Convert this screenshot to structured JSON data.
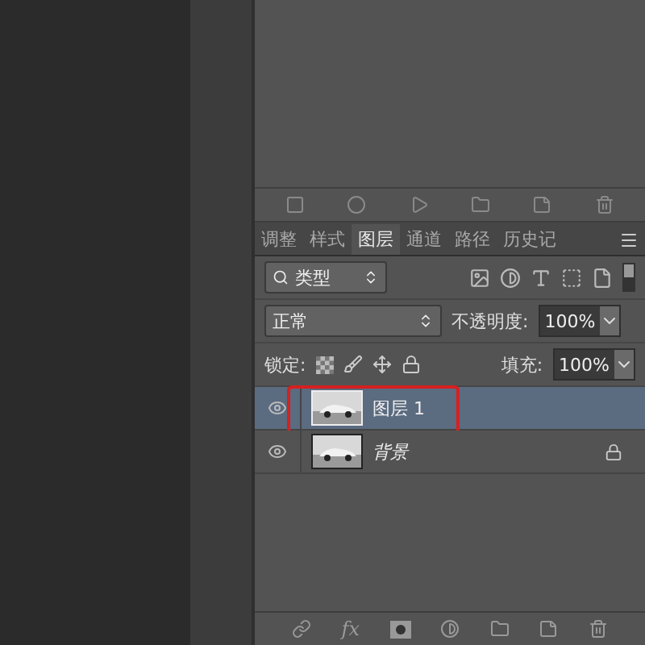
{
  "actions_toolbar": {
    "buttons": [
      {
        "kind": "stop"
      },
      {
        "kind": "record"
      },
      {
        "kind": "play"
      },
      {
        "kind": "folder"
      },
      {
        "kind": "new"
      },
      {
        "kind": "delete"
      }
    ]
  },
  "tabs": [
    {
      "label": "调整",
      "selected": false
    },
    {
      "label": "样式",
      "selected": false
    },
    {
      "label": "图层",
      "selected": true
    },
    {
      "label": "通道",
      "selected": false
    },
    {
      "label": "路径",
      "selected": false
    },
    {
      "label": "历史记",
      "selected": false
    }
  ],
  "filter": {
    "value": "类型",
    "on": true
  },
  "blend_mode": {
    "value": "正常"
  },
  "opacity": {
    "label": "不透明度:",
    "value": "100%"
  },
  "lock": {
    "label": "锁定:"
  },
  "fill": {
    "label": "填充:",
    "value": "100%"
  },
  "layers": [
    {
      "name": "图层 1",
      "kind": "layer",
      "selected": true,
      "visible": true,
      "locked": false,
      "highlighted": true
    },
    {
      "name": "背景",
      "kind": "background",
      "selected": false,
      "visible": true,
      "locked": true,
      "highlighted": false
    }
  ],
  "bottom_toolbar": {
    "effects_label": "fx"
  }
}
